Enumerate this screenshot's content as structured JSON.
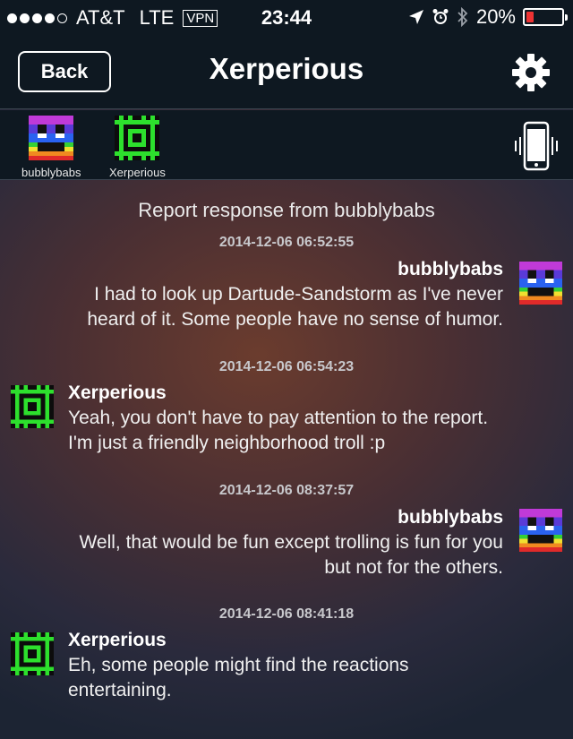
{
  "status_bar": {
    "carrier": "AT&T",
    "network": "LTE",
    "vpn": "VPN",
    "time": "23:44",
    "battery": "20%",
    "signal_bars_filled": 4,
    "signal_bars_total": 5,
    "battery_level": 0.2
  },
  "nav": {
    "back_label": "Back",
    "title": "Xerperious"
  },
  "participants": [
    {
      "name": "bubblybabs",
      "avatar": "rainbow-avatar"
    },
    {
      "name": "Xerperious",
      "avatar": "green-avatar"
    }
  ],
  "conversation": {
    "heading": "Report response from bubblybabs",
    "messages": [
      {
        "timestamp": "2014-12-06 06:52:55",
        "sender": "bubblybabs",
        "side": "right",
        "lines": [
          "I had to look up Dartude-Sandstorm as I've never",
          "heard of it.  Some people have no sense of humor."
        ]
      },
      {
        "timestamp": "2014-12-06 06:54:23",
        "sender": "Xerperious",
        "side": "left",
        "lines": [
          "Yeah, you don't have to pay attention to the report.",
          "I'm just a friendly neighborhood troll :p"
        ]
      },
      {
        "timestamp": "2014-12-06 08:37:57",
        "sender": "bubblybabs",
        "side": "right",
        "lines": [
          "Well, that would be fun except trolling is fun for you",
          "but not for the others."
        ]
      },
      {
        "timestamp": "2014-12-06 08:41:18",
        "sender": "Xerperious",
        "side": "left",
        "lines": [
          "Eh, some people might find the reactions",
          "entertaining."
        ]
      }
    ]
  },
  "colors": {
    "bar_background": "#0e1821",
    "avatar_green": "#2de02d",
    "battery_low": "#e33333"
  }
}
